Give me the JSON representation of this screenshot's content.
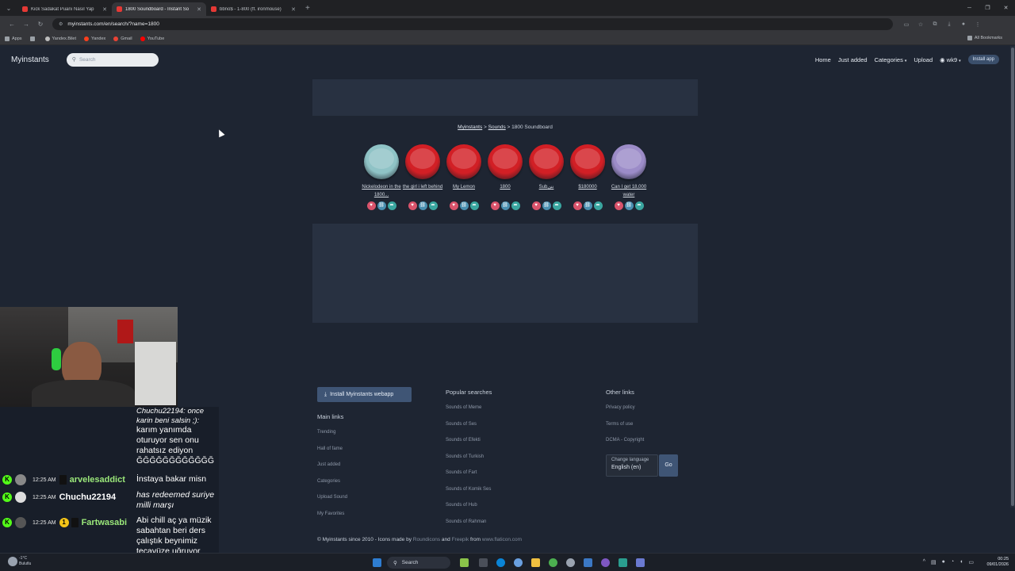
{
  "browser": {
    "tabs": [
      {
        "title": "Kick Sadakat Puanı Nasıl Yap",
        "active": false
      },
      {
        "title": "1800 Soundboard - Instant So",
        "active": true
      },
      {
        "title": "bbno$ - 1-800 (ft. ironmouse)",
        "active": false
      }
    ],
    "url": "myinstants.com/en/search/?name=1800",
    "bookmarks": [
      "Apps",
      "Yandex.Bilet",
      "Yandex",
      "Gmail",
      "YouTube"
    ],
    "all_bookmarks": "All Bookmarks"
  },
  "header": {
    "logo": "Myinstants",
    "search_placeholder": "Search",
    "nav": [
      "Home",
      "Just added",
      "Categories",
      "Upload"
    ],
    "user": "wk9",
    "install": "Install app"
  },
  "breadcrumb": {
    "a": "Myinstants",
    "sep1": " > ",
    "b": "Sounds",
    "sep2": " > ",
    "c": "1800 Soundboard"
  },
  "sounds": [
    {
      "label": "Nickelodeon in the 1800...",
      "color": "#8fc3c6"
    },
    {
      "label": "the girl i left behind",
      "color": "#d21f25"
    },
    {
      "label": "My Lemon",
      "color": "#d21f25"
    },
    {
      "label": "1800",
      "color": "#d21f25"
    },
    {
      "label": "Subننن",
      "color": "#d21f25"
    },
    {
      "label": "$180000",
      "color": "#d21f25"
    },
    {
      "label": "Can I get 18,000 water",
      "color": "#9c8cc8"
    }
  ],
  "footer": {
    "install_webapp": "Install Myinstants webapp",
    "main_links_title": "Main links",
    "main_links": [
      "Trending",
      "Hall of fame",
      "Just added",
      "Categories",
      "Upload Sound",
      "My Favorites"
    ],
    "popular_title": "Popular searches",
    "popular": [
      "Sounds of Meme",
      "Sounds of Ses",
      "Sounds of Efekti",
      "Sounds of Turkish",
      "Sounds of Fart",
      "Sounds of Komik Ses",
      "Sounds of Hub",
      "Sounds of Rahman"
    ],
    "other_title": "Other links",
    "other": [
      "Privacy policy",
      "Terms of use",
      "DCMA - Copyright"
    ],
    "lang_label": "Change language",
    "lang_value": "English (en)",
    "go": "Go",
    "copyright_a": "© Myinstants since 2010 - Icons made by ",
    "roundicons": "Roundicons",
    "and": " and ",
    "freepik": "Freepik",
    "from": " from ",
    "flaticon": "www.flaticon.com"
  },
  "chat": {
    "m1": "Chuchu22194: once karin beni salsin ;):",
    "m2": "karım yanımda oturuyor sen onu rahatsız ediyon ĞĞĞĞĞĞĞĞĞĞĞĞ",
    "r1": {
      "time": "12:25 AM",
      "user": "arvelesaddict",
      "text": "İnstaya bakar misn"
    },
    "r2": {
      "time": "12:25 AM",
      "user": "Chuchu22194",
      "text": "has redeemed suriye milli marşı"
    },
    "r3": {
      "time": "12:25 AM",
      "user": "Fartwasabi",
      "text": "Abi chill aç ya müzik sabahtan beri ders çalıştık beynimiz tecavüze uğruyor"
    }
  },
  "taskbar": {
    "search": "Search",
    "weather_temp": "-1°C",
    "weather_desc": "Bulutlu",
    "time": "00:25",
    "date": "09/01/2026"
  }
}
